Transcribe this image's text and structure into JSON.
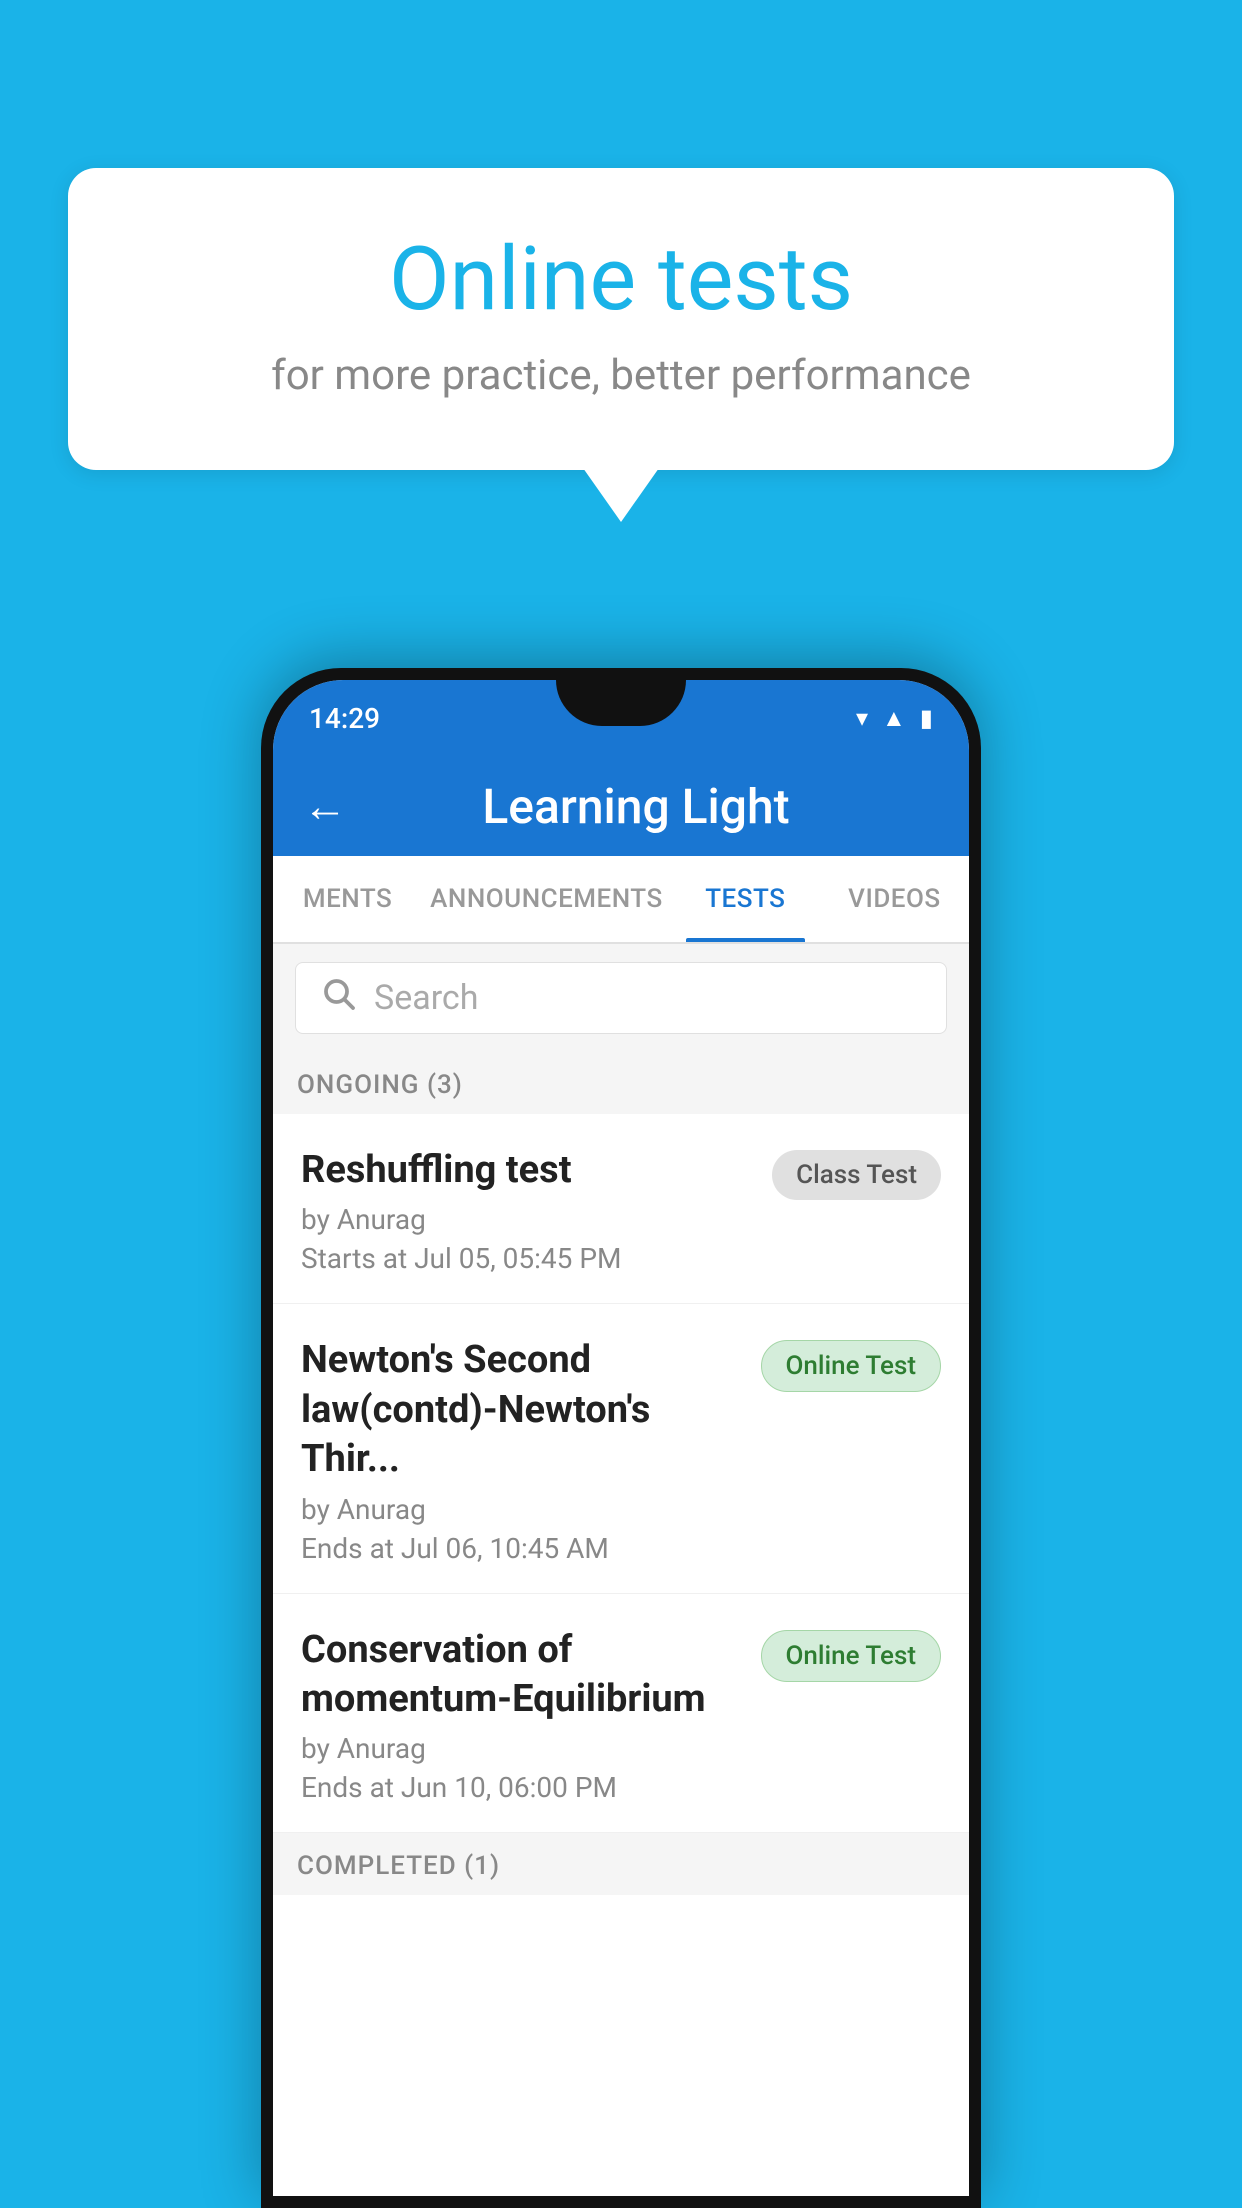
{
  "background": {
    "color": "#1ab3e8"
  },
  "speech_bubble": {
    "title": "Online tests",
    "subtitle": "for more practice, better performance"
  },
  "phone": {
    "status_bar": {
      "time": "14:29",
      "wifi_icon": "▼",
      "signal_icon": "▲",
      "battery_icon": "▮"
    },
    "app_bar": {
      "back_label": "←",
      "title": "Learning Light"
    },
    "tabs": [
      {
        "label": "MENTS",
        "active": false
      },
      {
        "label": "ANNOUNCEMENTS",
        "active": false
      },
      {
        "label": "TESTS",
        "active": true
      },
      {
        "label": "VIDEOS",
        "active": false
      }
    ],
    "search": {
      "placeholder": "Search"
    },
    "ongoing_section": {
      "header": "ONGOING (3)"
    },
    "tests": [
      {
        "name": "Reshuffling test",
        "author": "by Anurag",
        "time_label": "Starts at",
        "time": "Jul 05, 05:45 PM",
        "badge": "Class Test",
        "badge_type": "class"
      },
      {
        "name": "Newton's Second law(contd)-Newton's Thir...",
        "author": "by Anurag",
        "time_label": "Ends at",
        "time": "Jul 06, 10:45 AM",
        "badge": "Online Test",
        "badge_type": "online"
      },
      {
        "name": "Conservation of momentum-Equilibrium",
        "author": "by Anurag",
        "time_label": "Ends at",
        "time": "Jun 10, 06:00 PM",
        "badge": "Online Test",
        "badge_type": "online"
      }
    ],
    "completed_section": {
      "header": "COMPLETED (1)"
    }
  }
}
